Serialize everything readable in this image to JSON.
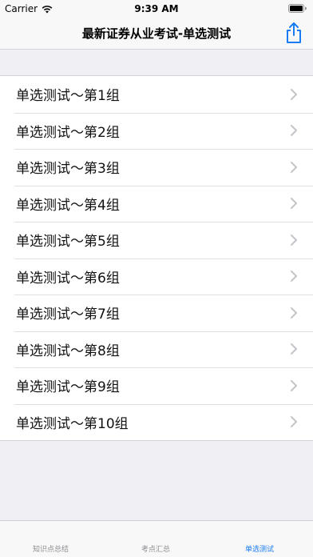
{
  "status_bar": {
    "carrier": "Carrier",
    "time": "9:39 AM"
  },
  "nav": {
    "title": "最新证券从业考试-单选测试",
    "share_icon": "share-icon"
  },
  "list": {
    "items": [
      {
        "label": "单选测试～第1组"
      },
      {
        "label": "单选测试～第2组"
      },
      {
        "label": "单选测试～第3组"
      },
      {
        "label": "单选测试～第4组"
      },
      {
        "label": "单选测试～第5组"
      },
      {
        "label": "单选测试～第6组"
      },
      {
        "label": "单选测试～第7组"
      },
      {
        "label": "单选测试～第8组"
      },
      {
        "label": "单选测试～第9组"
      },
      {
        "label": "单选测试～第10组"
      }
    ]
  },
  "tabs": [
    {
      "label": "知识点总结",
      "active": false
    },
    {
      "label": "考点汇总",
      "active": false
    },
    {
      "label": "单选测试",
      "active": true
    }
  ],
  "colors": {
    "accent": "#1a7cf5",
    "background": "#efeff4",
    "bar": "#f8f8f8"
  }
}
